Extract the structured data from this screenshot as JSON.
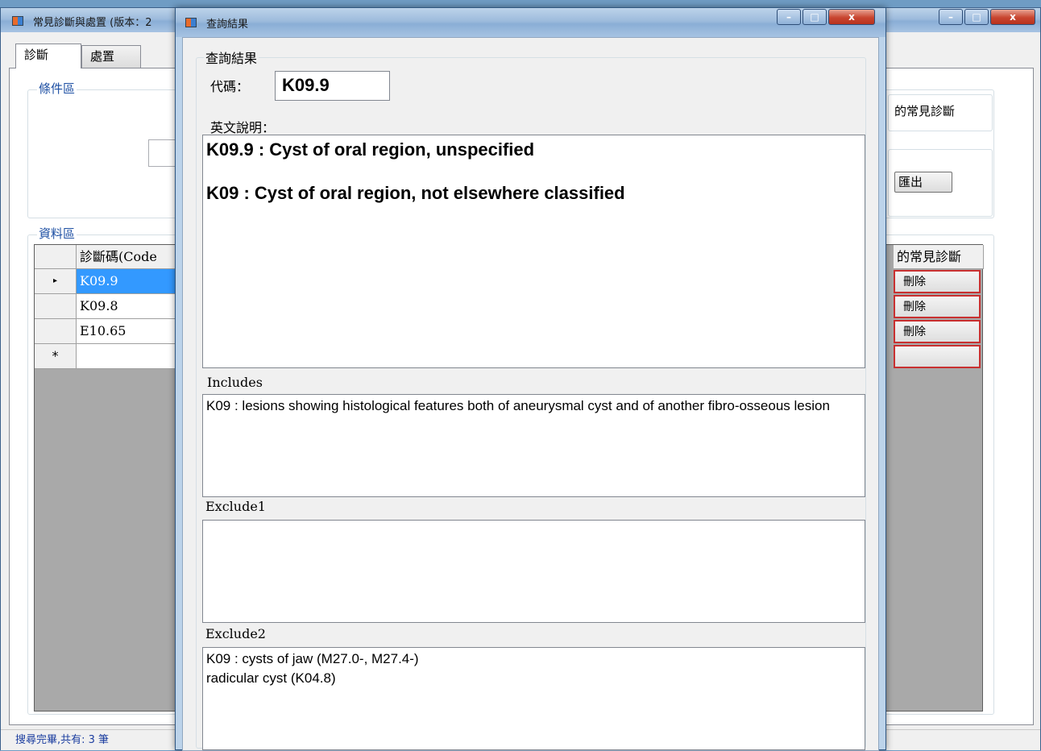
{
  "main_window": {
    "title": "常見診斷與處置 (版本：2",
    "tabs": [
      "診斷",
      "處置"
    ],
    "condition_group_label": "條件區",
    "right_group_text": "的常見診斷",
    "export_button": "匯出",
    "data_group_label": "資料區",
    "grid": {
      "header_code": "診斷碼(Code",
      "header_right": "的常見診斷",
      "rows": [
        {
          "code": "K09.9",
          "action": "刪除",
          "selected": true
        },
        {
          "code": "K09.8",
          "action": "刪除",
          "selected": false
        },
        {
          "code": "E10.65",
          "action": "刪除",
          "selected": false
        }
      ],
      "new_row_marker": "*",
      "current_row_marker": "▸"
    },
    "status": "搜尋完畢,共有: 3 筆"
  },
  "dialog": {
    "title": "查詢結果",
    "group_label": "查詢結果",
    "code_label": "代碼：",
    "code_value": "K09.9",
    "english_label": "英文說明：",
    "english_lines": [
      "K09.9 : Cyst of oral region, unspecified",
      "K09 : Cyst of oral region, not elsewhere classified"
    ],
    "includes_label": "Includes",
    "includes_text": "K09 : lesions showing histological features both of aneurysmal cyst and of another fibro-osseous lesion",
    "exclude1_label": "Exclude1",
    "exclude1_text": "",
    "exclude2_label": "Exclude2",
    "exclude2_lines": [
      "K09 : cysts of jaw (M27.0-, M27.4-)",
      "radicular cyst (K04.8)"
    ]
  },
  "window_buttons": {
    "minimize": "–",
    "maximize": "□",
    "close": "x"
  }
}
